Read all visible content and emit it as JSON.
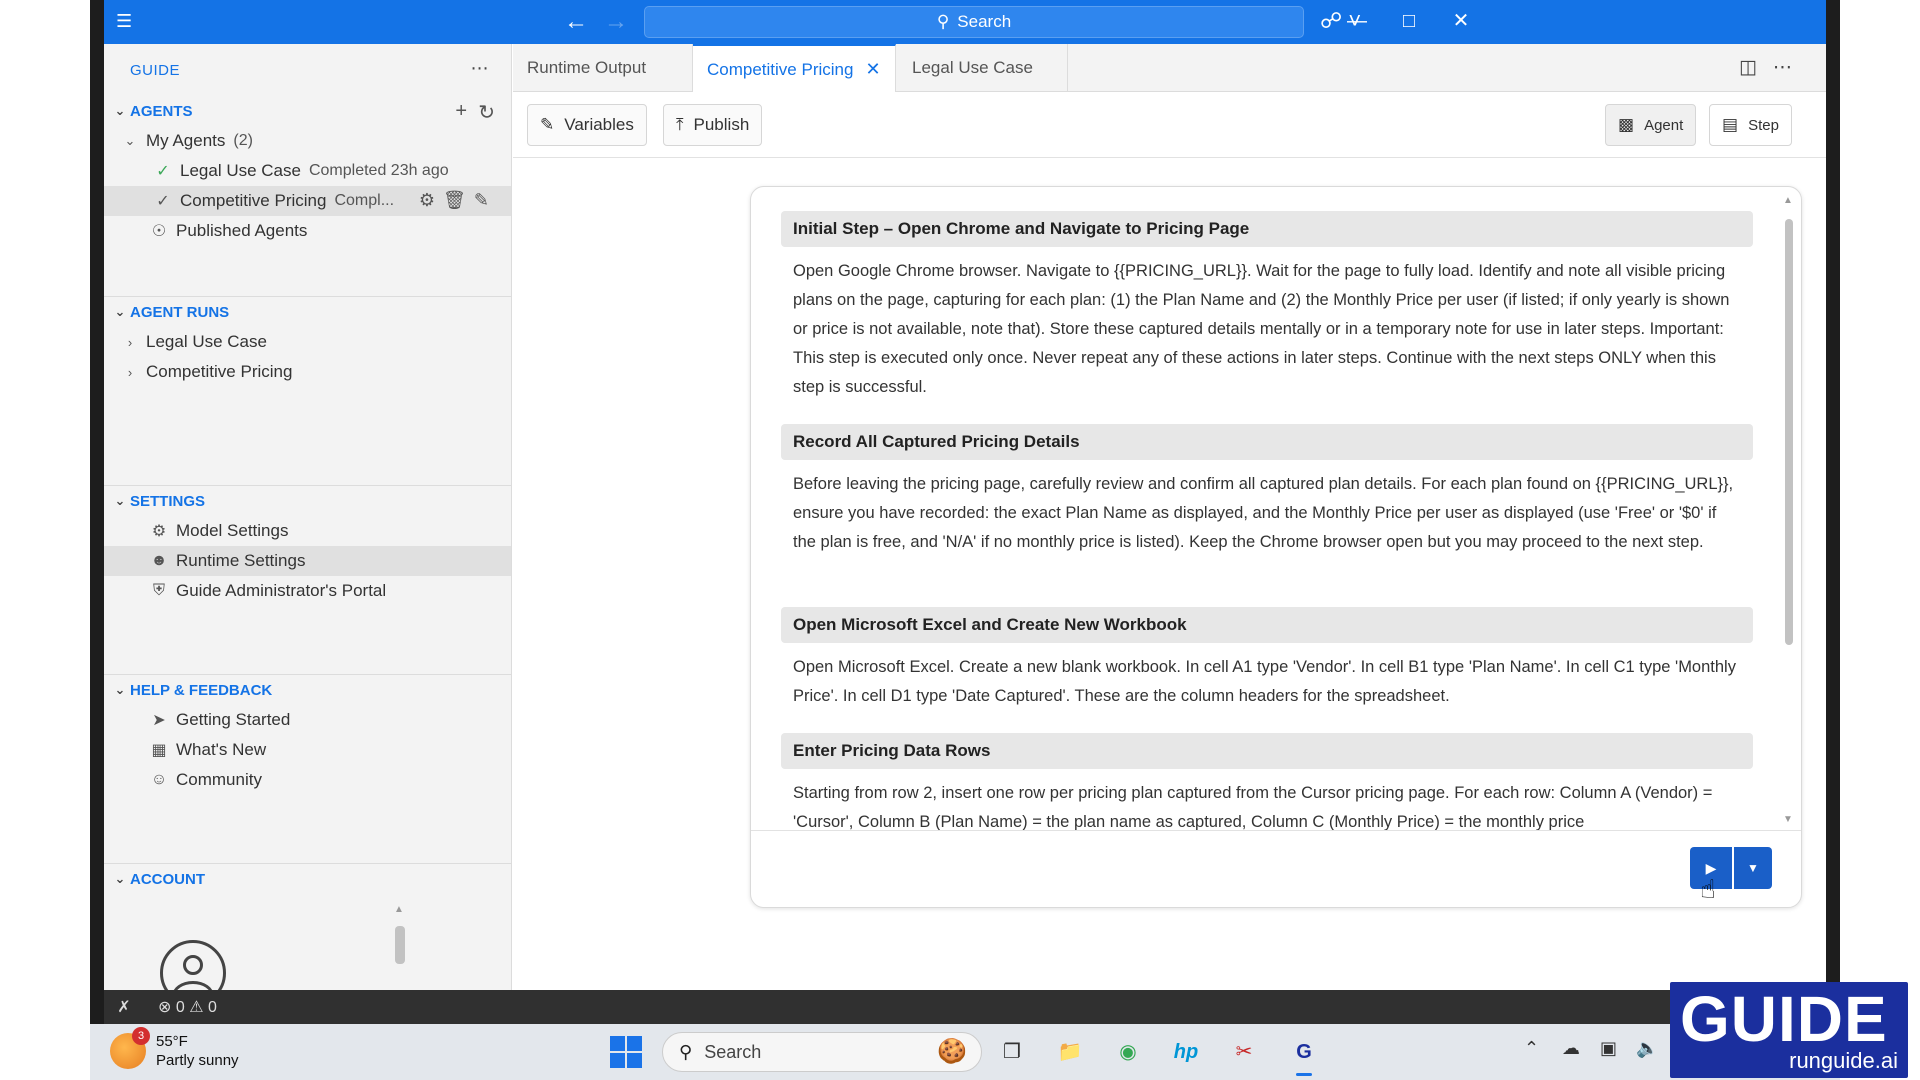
{
  "titlebar": {
    "search_label": "Search"
  },
  "sidebar": {
    "header": "GUIDE",
    "agents": {
      "title": "AGENTS",
      "my_agents_label": "My Agents",
      "my_agents_count": "(2)",
      "items": [
        {
          "name": "Legal Use Case",
          "status": "Completed 23h ago"
        },
        {
          "name": "Competitive Pricing",
          "status": "Compl..."
        }
      ],
      "published": "Published Agents"
    },
    "agent_runs": {
      "title": "AGENT RUNS",
      "items": [
        "Legal Use Case",
        "Competitive Pricing"
      ]
    },
    "settings": {
      "title": "SETTINGS",
      "items": [
        "Model Settings",
        "Runtime Settings",
        "Guide Administrator's Portal"
      ]
    },
    "help": {
      "title": "HELP & FEEDBACK",
      "items": [
        "Getting Started",
        "What's New",
        "Community"
      ]
    },
    "account": {
      "title": "ACCOUNT"
    }
  },
  "tabs": [
    {
      "label": "Runtime Output"
    },
    {
      "label": "Competitive Pricing"
    },
    {
      "label": "Legal Use Case"
    }
  ],
  "toolbar": {
    "variables": "Variables",
    "publish": "Publish",
    "agent": "Agent",
    "step": "Step"
  },
  "steps": [
    {
      "title": "Initial Step – Open Chrome and Navigate to Pricing Page",
      "body": "Open Google Chrome browser. Navigate to {{PRICING_URL}}. Wait for the page to fully load. Identify and note all visible pricing plans on the page, capturing for each plan: (1) the Plan Name and (2) the Monthly Price per user (if listed; if only yearly is shown or price is not available, note that). Store these captured details mentally or in a temporary note for use in later steps. Important: This step is executed only once. Never repeat any of these actions in later steps. Continue with the next steps ONLY when this step is successful."
    },
    {
      "title": "Record All Captured Pricing Details",
      "body": "Before leaving the pricing page, carefully review and confirm all captured plan details. For each plan found on {{PRICING_URL}}, ensure you have recorded: the exact Plan Name as displayed, and the Monthly Price per user as displayed (use 'Free' or '$0' if the plan is free, and 'N/A' if no monthly price is listed). Keep the Chrome browser open but you may proceed to the next step."
    },
    {
      "title": "Open Microsoft Excel and Create New Workbook",
      "body": "Open Microsoft Excel. Create a new blank workbook. In cell A1 type 'Vendor'. In cell B1 type 'Plan Name'. In cell C1 type 'Monthly Price'. In cell D1 type 'Date Captured'. These are the column headers for the spreadsheet."
    },
    {
      "title": "Enter Pricing Data Rows",
      "body": "Starting from row 2, insert one row per pricing plan captured from the Cursor pricing page. For each row: Column A (Vendor) = 'Cursor', Column B (Plan Name) = the plan name as captured, Column C (Monthly Price) = the monthly price"
    }
  ],
  "statusbar": {
    "errors": "0",
    "warnings": "0"
  },
  "taskbar": {
    "weather_temp": "55°F",
    "weather_desc": "Partly sunny",
    "weather_badge": "3",
    "search_label": "Search"
  },
  "watermark": {
    "brand": "GUIDE",
    "site": "runguide.ai"
  }
}
